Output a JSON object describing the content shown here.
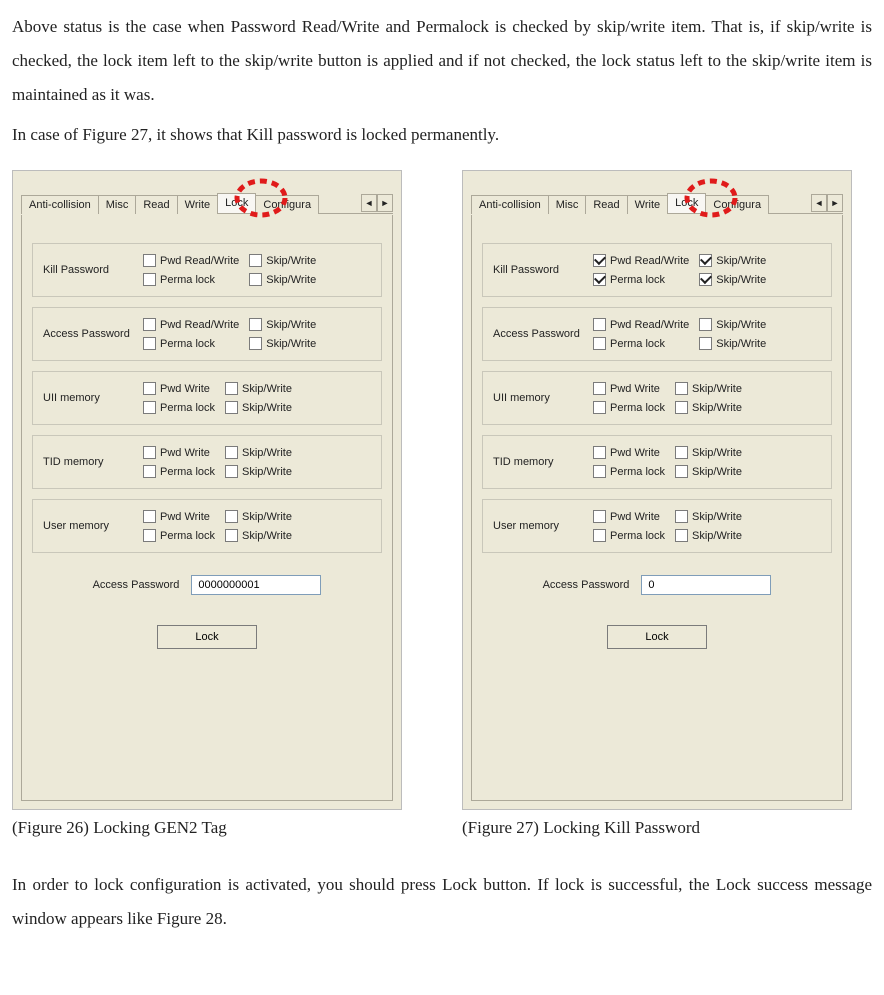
{
  "paragraphs": {
    "p1": "Above status is the case when Password Read/Write and Permalock is checked by skip/write item. That is, if skip/write is checked, the lock item left to the skip/write button is applied and if not checked, the lock status left to the skip/write item is maintained as it was.",
    "p2": "In case of Figure 27, it shows that Kill password is locked permanently.",
    "p3": "In order to lock configuration is activated, you should press Lock button. If lock is successful, the Lock success message window appears like Figure 28."
  },
  "tabs": {
    "t0": "Anti-collision",
    "t1": "Misc",
    "t2": "Read",
    "t3": "Write",
    "t4": "Lock",
    "t5": "Configura",
    "left_arrow": "◄",
    "right_arrow": "►"
  },
  "groups": {
    "g0": "Kill Password",
    "g1": "Access Password",
    "g2": "UII memory",
    "g3": "TID memory",
    "g4": "User memory"
  },
  "checks": {
    "pwd_rw": "Pwd Read/Write",
    "pwd_w": "Pwd Write",
    "perma": "Perma lock",
    "skip": "Skip/Write"
  },
  "access_password_label": "Access Password",
  "lock_button": "Lock",
  "figure_left": {
    "ap_value": "0000000001",
    "caption": "(Figure 26) Locking GEN2 Tag"
  },
  "figure_right": {
    "ap_value": "0",
    "caption": "(Figure 27) Locking Kill Password"
  }
}
